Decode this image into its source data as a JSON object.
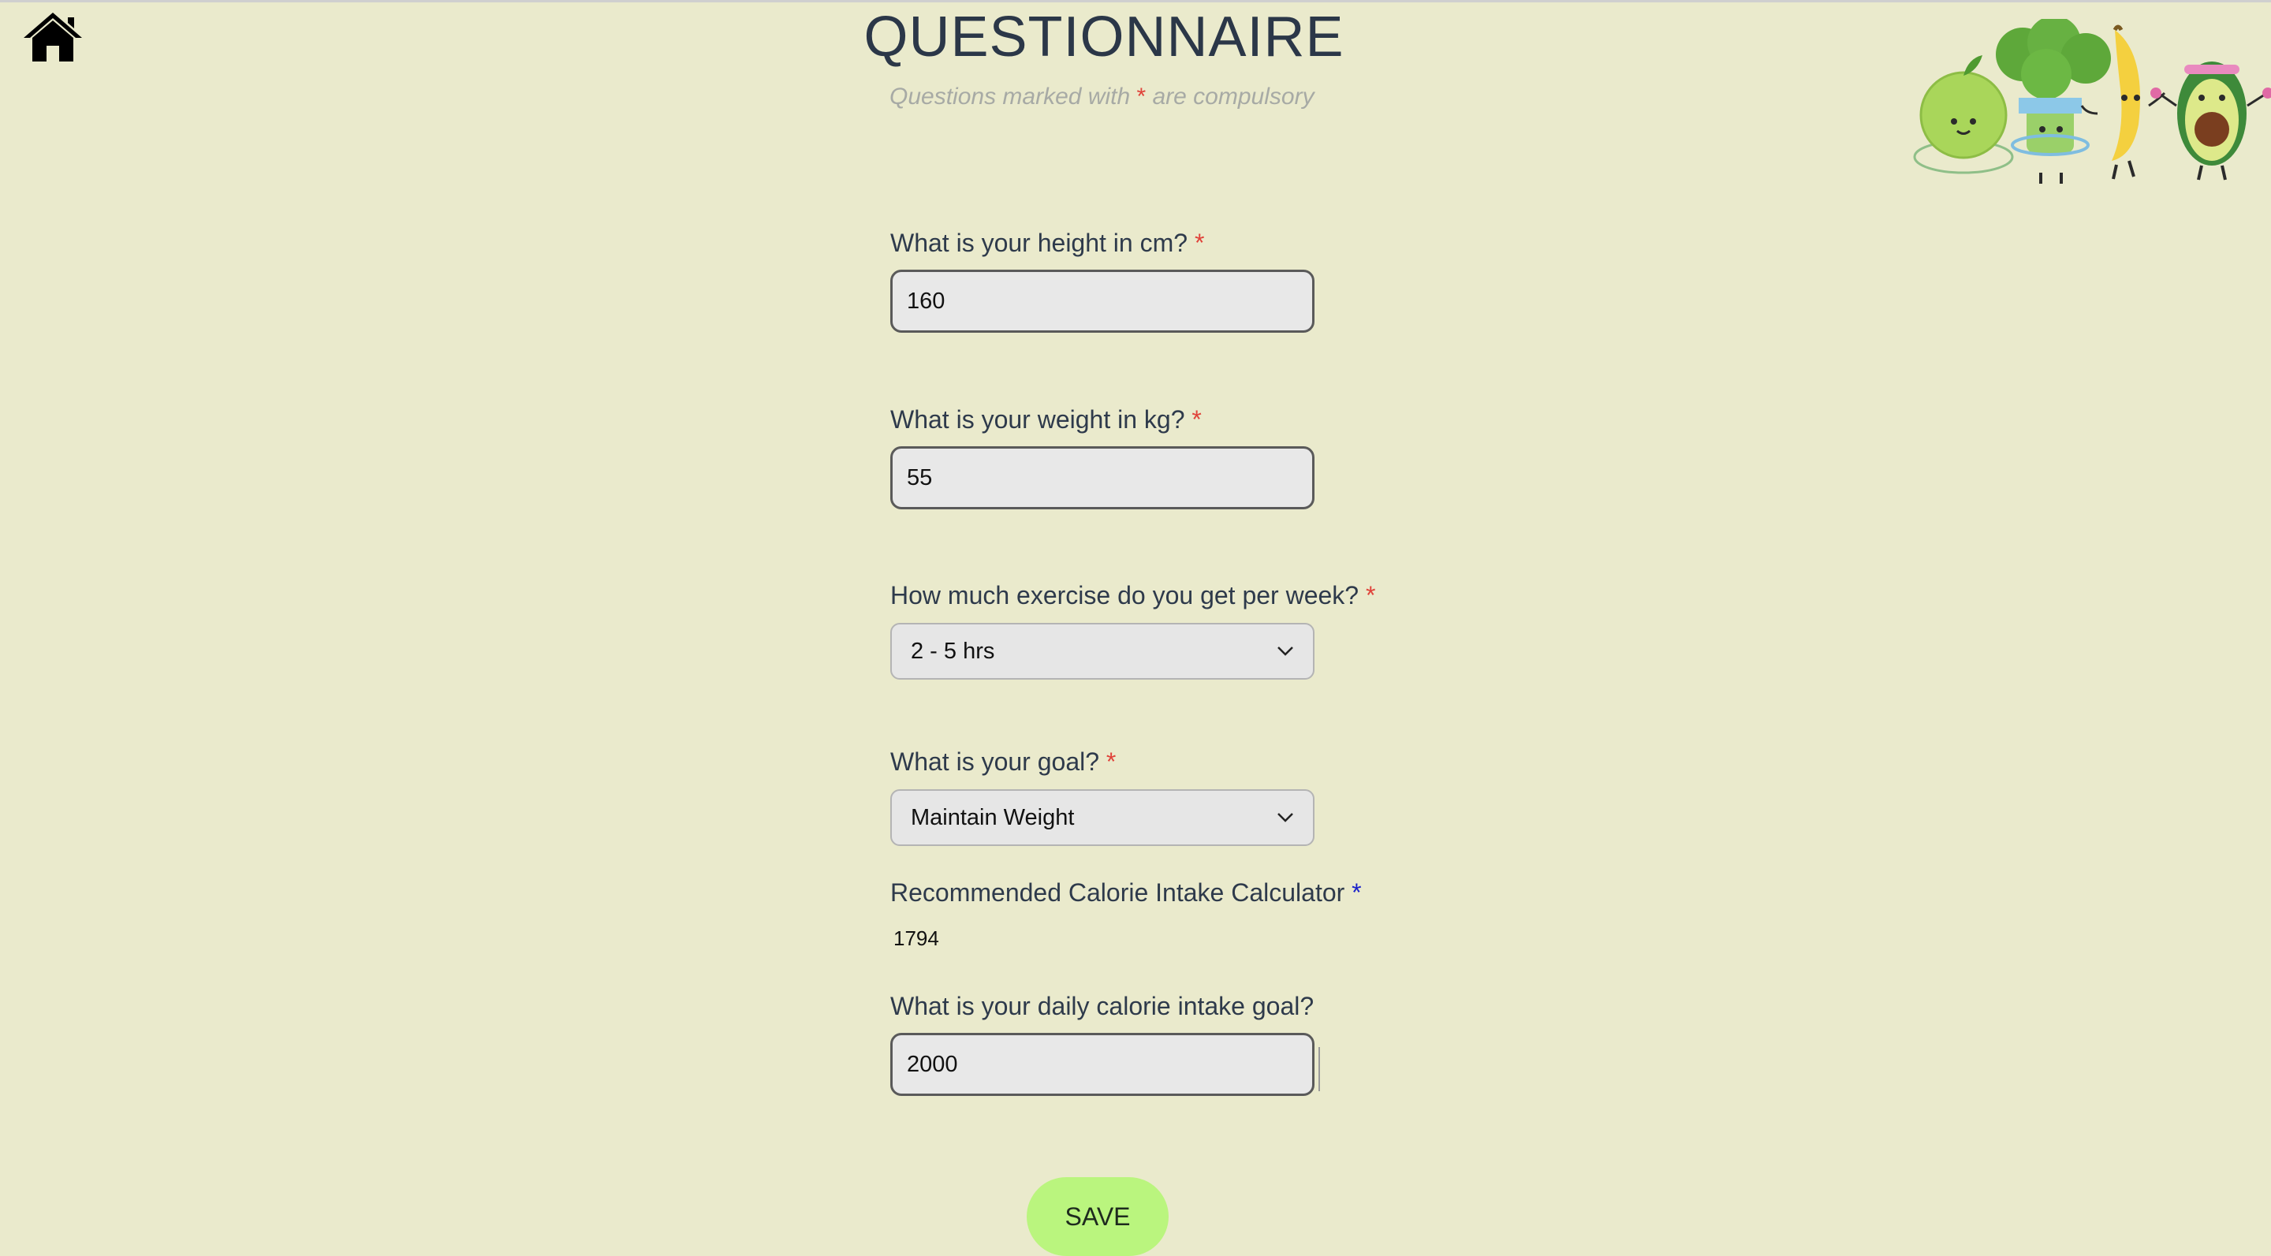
{
  "header": {
    "title": "QUESTIONNAIRE",
    "subtitle_before": "Questions marked with ",
    "required_marker": "*",
    "subtitle_after": " are compulsory"
  },
  "icons": {
    "home": "home-icon",
    "mascots": "fruit-vegetable-mascots-illustration"
  },
  "form": {
    "height": {
      "label": "What is your height in cm?",
      "required": "*",
      "value": "160"
    },
    "weight": {
      "label": "What is your weight in kg?",
      "required": "*",
      "value": "55"
    },
    "exercise": {
      "label": "How much exercise do you get per week?",
      "required": "*",
      "selected": "2 - 5 hrs"
    },
    "goal": {
      "label": "What is your goal?",
      "required": "*",
      "selected": "Maintain Weight"
    },
    "recommended": {
      "label": "Recommended Calorie Intake Calculator",
      "required": "*",
      "value": "1794"
    },
    "calorie_goal": {
      "label": "What is your daily calorie intake goal?",
      "value": "2000"
    },
    "save_label": "SAVE"
  },
  "colors": {
    "background": "#eaeacc",
    "required_star": "#e0433a",
    "required_star_blue": "#1b22c9",
    "save_button": "#baf57e"
  }
}
